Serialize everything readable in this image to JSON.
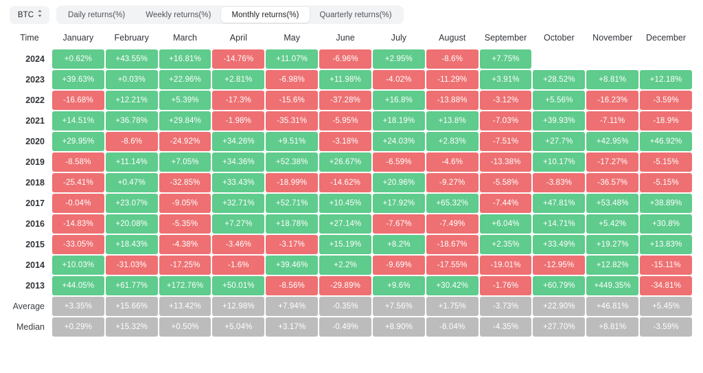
{
  "toolbar": {
    "asset": {
      "label": "BTC",
      "icon": "stepper-updown-icon"
    },
    "tabs": [
      {
        "label": "Daily returns(%)",
        "active": false
      },
      {
        "label": "Weekly returns(%)",
        "active": false
      },
      {
        "label": "Monthly returns(%)",
        "active": true
      },
      {
        "label": "Quarterly returns(%)",
        "active": false
      }
    ]
  },
  "colors": {
    "positive": "#5fcb8c",
    "negative": "#ee7072",
    "neutral": "#bcbcbc",
    "toolbar_bg": "#f2f3f5",
    "active_tab_bg": "#ffffff",
    "text": "#2f3237"
  },
  "chart_data": {
    "type": "heatmap",
    "title": "Monthly returns(%)",
    "asset": "BTC",
    "xlabel": "",
    "ylabel": "Time",
    "value_unit": "%",
    "columns": [
      "Time",
      "January",
      "February",
      "March",
      "April",
      "May",
      "June",
      "July",
      "August",
      "September",
      "October",
      "November",
      "December"
    ],
    "categories": [
      "January",
      "February",
      "March",
      "April",
      "May",
      "June",
      "July",
      "August",
      "September",
      "October",
      "November",
      "December"
    ],
    "rows": [
      {
        "label": "2024",
        "kind": "year",
        "values": [
          "+0.62%",
          "+43.55%",
          "+16.81%",
          "-14.76%",
          "+11.07%",
          "-6.96%",
          "+2.95%",
          "-8.6%",
          "+7.75%",
          "",
          "",
          ""
        ]
      },
      {
        "label": "2023",
        "kind": "year",
        "values": [
          "+39.63%",
          "+0.03%",
          "+22.96%",
          "+2.81%",
          "-6.98%",
          "+11.98%",
          "-4.02%",
          "-11.29%",
          "+3.91%",
          "+28.52%",
          "+8.81%",
          "+12.18%"
        ]
      },
      {
        "label": "2022",
        "kind": "year",
        "values": [
          "-16.68%",
          "+12.21%",
          "+5.39%",
          "-17.3%",
          "-15.6%",
          "-37.28%",
          "+16.8%",
          "-13.88%",
          "-3.12%",
          "+5.56%",
          "-16.23%",
          "-3.59%"
        ]
      },
      {
        "label": "2021",
        "kind": "year",
        "values": [
          "+14.51%",
          "+36.78%",
          "+29.84%",
          "-1.98%",
          "-35.31%",
          "-5.95%",
          "+18.19%",
          "+13.8%",
          "-7.03%",
          "+39.93%",
          "-7.11%",
          "-18.9%"
        ]
      },
      {
        "label": "2020",
        "kind": "year",
        "values": [
          "+29.95%",
          "-8.6%",
          "-24.92%",
          "+34.26%",
          "+9.51%",
          "-3.18%",
          "+24.03%",
          "+2.83%",
          "-7.51%",
          "+27.7%",
          "+42.95%",
          "+46.92%"
        ]
      },
      {
        "label": "2019",
        "kind": "year",
        "values": [
          "-8.58%",
          "+11.14%",
          "+7.05%",
          "+34.36%",
          "+52.38%",
          "+26.67%",
          "-6.59%",
          "-4.6%",
          "-13.38%",
          "+10.17%",
          "-17.27%",
          "-5.15%"
        ]
      },
      {
        "label": "2018",
        "kind": "year",
        "values": [
          "-25.41%",
          "+0.47%",
          "-32.85%",
          "+33.43%",
          "-18.99%",
          "-14.62%",
          "+20.96%",
          "-9.27%",
          "-5.58%",
          "-3.83%",
          "-36.57%",
          "-5.15%"
        ]
      },
      {
        "label": "2017",
        "kind": "year",
        "values": [
          "-0.04%",
          "+23.07%",
          "-9.05%",
          "+32.71%",
          "+52.71%",
          "+10.45%",
          "+17.92%",
          "+65.32%",
          "-7.44%",
          "+47.81%",
          "+53.48%",
          "+38.89%"
        ]
      },
      {
        "label": "2016",
        "kind": "year",
        "values": [
          "-14.83%",
          "+20.08%",
          "-5.35%",
          "+7.27%",
          "+18.78%",
          "+27.14%",
          "-7.67%",
          "-7.49%",
          "+6.04%",
          "+14.71%",
          "+5.42%",
          "+30.8%"
        ]
      },
      {
        "label": "2015",
        "kind": "year",
        "values": [
          "-33.05%",
          "+18.43%",
          "-4.38%",
          "-3.46%",
          "-3.17%",
          "+15.19%",
          "+8.2%",
          "-18.67%",
          "+2.35%",
          "+33.49%",
          "+19.27%",
          "+13.83%"
        ]
      },
      {
        "label": "2014",
        "kind": "year",
        "values": [
          "+10.03%",
          "-31.03%",
          "-17.25%",
          "-1.6%",
          "+39.46%",
          "+2.2%",
          "-9.69%",
          "-17.55%",
          "-19.01%",
          "-12.95%",
          "+12.82%",
          "-15.11%"
        ]
      },
      {
        "label": "2013",
        "kind": "year",
        "values": [
          "+44.05%",
          "+61.77%",
          "+172.76%",
          "+50.01%",
          "-8.56%",
          "-29.89%",
          "+9.6%",
          "+30.42%",
          "-1.76%",
          "+60.79%",
          "+449.35%",
          "-34.81%"
        ]
      },
      {
        "label": "Average",
        "kind": "summary",
        "values": [
          "+3.35%",
          "+15.66%",
          "+13.42%",
          "+12.98%",
          "+7.94%",
          "-0.35%",
          "+7.56%",
          "+1.75%",
          "-3.73%",
          "+22.90%",
          "+46.81%",
          "+5.45%"
        ]
      },
      {
        "label": "Median",
        "kind": "summary",
        "values": [
          "+0.29%",
          "+15.32%",
          "+0.50%",
          "+5.04%",
          "+3.17%",
          "-0.49%",
          "+8.90%",
          "-8.04%",
          "-4.35%",
          "+27.70%",
          "+8.81%",
          "-3.59%"
        ]
      }
    ]
  }
}
